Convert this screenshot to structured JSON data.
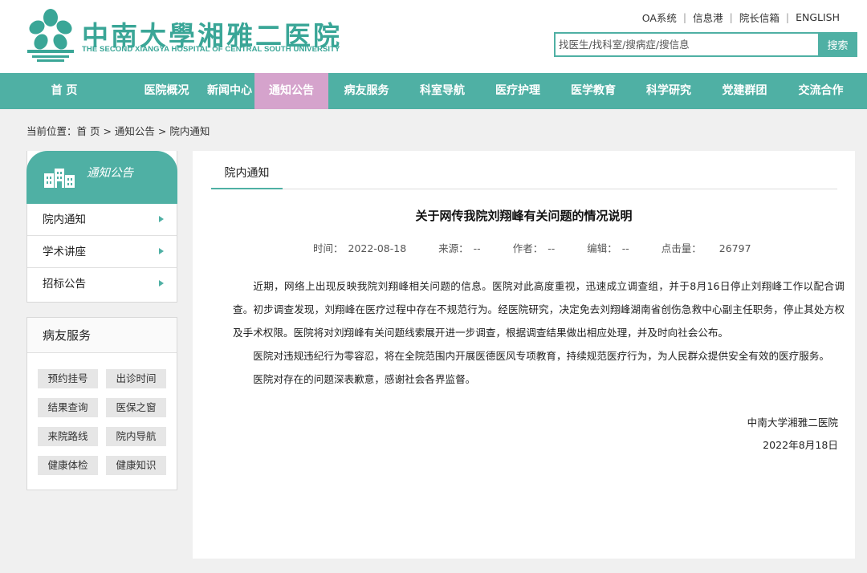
{
  "header": {
    "logo_cn": "中南大學湘雅二医院",
    "logo_en": "THE SECOND XIANGYA HOSPITAL OF CENTRAL SOUTH UNIVERSITY",
    "top_links": [
      "OA系统",
      "信息港",
      "院长信箱",
      "ENGLISH"
    ],
    "search_placeholder": "找医生/找科室/搜病症/搜信息",
    "search_button": "搜索"
  },
  "nav": {
    "items": [
      "首 页",
      "医院概况",
      "新闻中心",
      "通知公告",
      "病友服务",
      "科室导航",
      "医疗护理",
      "医学教育",
      "科学研究",
      "党建群团",
      "交流合作"
    ],
    "active": "通知公告"
  },
  "breadcrumb": "当前位置：首 页 > 通知公告 > 院内通知",
  "sidebar": {
    "section_title": "通知公告",
    "items": [
      "院内通知",
      "学术讲座",
      "招标公告"
    ],
    "services_title": "病友服务",
    "services": [
      "预约挂号",
      "出诊时间",
      "结果查询",
      "医保之窗",
      "来院路线",
      "院内导航",
      "健康体检",
      "健康知识"
    ]
  },
  "article": {
    "tab": "院内通知",
    "title": "关于网传我院刘翔峰有关问题的情况说明",
    "meta": {
      "time_label": "时间：",
      "time": "2022-08-18",
      "source_label": "来源：",
      "source": "--",
      "author_label": "作者：",
      "author": "--",
      "editor_label": "编辑：",
      "editor": "--",
      "clicks_label": "点击量：",
      "clicks": "26797"
    },
    "paragraphs": [
      "近期，网络上出现反映我院刘翔峰相关问题的信息。医院对此高度重视，迅速成立调查组，并于8月16日停止刘翔峰工作以配合调查。初步调查发现，刘翔峰在医疗过程中存在不规范行为。经医院研究，决定免去刘翔峰湖南省创伤急救中心副主任职务，停止其处方权及手术权限。医院将对刘翔峰有关问题线索展开进一步调查，根据调查结果做出相应处理，并及时向社会公布。",
      "医院对违规违纪行为零容忍，将在全院范围内开展医德医风专项教育，持续规范医疗行为，为人民群众提供安全有效的医疗服务。",
      "医院对存在的问题深表歉意，感谢社会各界监督。"
    ],
    "signature": "中南大学湘雅二医院",
    "date": "2022年8月18日"
  },
  "colors": {
    "brand": "#4fb0a4",
    "nav_active": "#d5a3cc"
  }
}
